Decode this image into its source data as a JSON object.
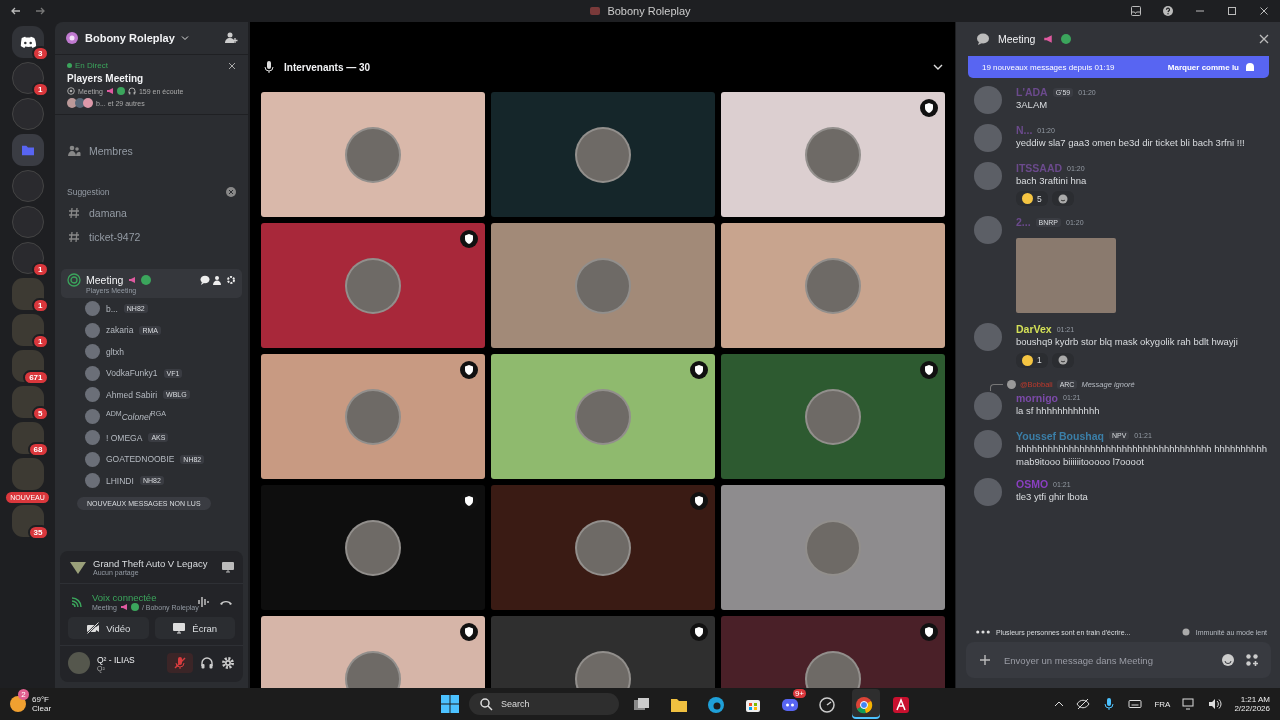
{
  "window": {
    "title": "Bobony Roleplay"
  },
  "servers": [
    {
      "kind": "home",
      "badge": "3"
    },
    {
      "kind": "server",
      "badge": "1"
    },
    {
      "kind": "server"
    },
    {
      "kind": "folder"
    },
    {
      "kind": "server"
    },
    {
      "kind": "server"
    },
    {
      "kind": "server",
      "badge": "1"
    },
    {
      "kind": "grid",
      "badge": "1"
    },
    {
      "kind": "grid",
      "badge": "1"
    },
    {
      "kind": "grid",
      "badge": "671"
    },
    {
      "kind": "grid",
      "badge": "5"
    },
    {
      "kind": "grid",
      "badge": "68"
    },
    {
      "kind": "grid"
    },
    {
      "kind": "grid",
      "badge": "35"
    }
  ],
  "new_pill": "NOUVEAU",
  "server_header": {
    "name": "Bobony Roleplay"
  },
  "live_event": {
    "status": "En Direct",
    "title": "Players Meeting",
    "channel": "Meeting",
    "listeners": "159 en écoute",
    "participants": "b... et 29 autres"
  },
  "members_link": "Membres",
  "category": {
    "name": "Suggestion",
    "channels": [
      "damana",
      "ticket-9472"
    ]
  },
  "voice_channel": {
    "name": "Meeting",
    "subtitle": "Players Meeting",
    "members": [
      {
        "name": "b...",
        "tag": "NH82"
      },
      {
        "name": "zakaria",
        "tag": "RMA"
      },
      {
        "name": "gltxh"
      },
      {
        "name": "VodkaFunky1",
        "tag": "VF1"
      },
      {
        "name": "Ahmed Sabiri",
        "tag": "WBLG"
      },
      {
        "name": "$^{ADM}$*Colonel*$^{RGA}$"
      },
      {
        "name": "! OMEGA",
        "tag": "AKS"
      },
      {
        "name": "GOATEDNOOBIE",
        "tag": "NH82"
      },
      {
        "name": "LHINDI",
        "tag": "NH82"
      }
    ]
  },
  "unread_pill": "NOUVEAUX MESSAGES NON LUS",
  "activity": {
    "game": "Grand Theft Auto V Legacy",
    "status": "Aucun partage"
  },
  "voice_status": {
    "title": "Voix connectée",
    "channel": "Meeting",
    "server": "/ Bobony Roleplay"
  },
  "media_buttons": [
    {
      "kind": "video",
      "label": "Vidéo"
    },
    {
      "kind": "screen",
      "label": "Écran"
    }
  ],
  "user": {
    "name": "Q² - ILIAS",
    "status": "Q²",
    "muted": true
  },
  "stage": {
    "title": "Intervenants — 30",
    "tiles": [
      {
        "color": "#d9b8aa",
        "shield": false
      },
      {
        "color": "#15262a",
        "shield": false
      },
      {
        "color": "#dccfd0",
        "shield": true
      },
      {
        "color": "#a8283a",
        "shield": true
      },
      {
        "color": "#a28a78",
        "shield": false
      },
      {
        "color": "#c8a48e",
        "shield": false
      },
      {
        "color": "#c89a82",
        "shield": true
      },
      {
        "color": "#8fba6e",
        "shield": true
      },
      {
        "color": "#2d5a30",
        "shield": true
      },
      {
        "color": "#0e0e0e",
        "shield": true
      },
      {
        "color": "#3a1b14",
        "shield": true
      },
      {
        "color": "#8e8c8e",
        "shield": false
      },
      {
        "color": "#d6b5a8",
        "shield": true
      },
      {
        "color": "#2f2f2f",
        "shield": true
      },
      {
        "color": "#4a2028",
        "shield": true
      }
    ]
  },
  "chat": {
    "title": "Meeting",
    "banner": {
      "text": "19 nouveaux messages depuis 01:19",
      "action": "Marquer comme lu"
    },
    "messages": [
      {
        "kind": "text",
        "author": "L'ADA",
        "color": "#6b4a8c",
        "tag": "G'59",
        "time": "01:20",
        "text": "3ALAM"
      },
      {
        "kind": "text",
        "author": "N...",
        "color": "#6b4a8c",
        "time": "01:20",
        "text": "yeddiw sla7 gaa3 omen be3d dir ticket bli bach 3rfni !!!"
      },
      {
        "kind": "text",
        "author": "ITSSAAD",
        "color": "#6b4a8c",
        "time": "01:20",
        "text": "bach 3raftini hna",
        "reactions": [
          "5"
        ]
      },
      {
        "kind": "image",
        "author": "2...",
        "color": "#6b4a8c",
        "tag": "BNRP",
        "time": "01:20"
      },
      {
        "kind": "text",
        "author": "DarVex",
        "color": "#d4e157",
        "time": "01:21",
        "text": "boushq9 kydrb stor blq mask okygolik rah bdlt hwayji",
        "reactions": [
          "1"
        ]
      },
      {
        "kind": "text",
        "author": "mornigo",
        "color": "#7b4aa8",
        "time": "01:21",
        "text": "la sf hhhhhhhhhhhh",
        "reply": {
          "author": "@Bobbali",
          "tag": "ARC",
          "text": "Message ignoré"
        }
      },
      {
        "kind": "text",
        "author": "Youssef Boushaq",
        "color": "#3b7fa8",
        "tag": "NPV",
        "time": "01:21",
        "text": "hhhhhhhhhhhhhhhhhhhhhhhhhhhhhhhhhhhhh hhhhhhhhhh mab9itooo biiiiiitooooo l7oooot"
      },
      {
        "kind": "text",
        "author": "OSMO",
        "color": "#8a3fc0",
        "time": "01:21",
        "text": "tle3 ytfi ghir lbota"
      }
    ],
    "typing": "Plusieurs personnes sont en train d'écrire...",
    "slowmode": "Immunité au mode lent",
    "placeholder": "Envoyer un message dans Meeting"
  },
  "taskbar": {
    "weather": {
      "temp": "69°F",
      "condition": "Clear",
      "badge": "2"
    },
    "search": "Search",
    "apps": [
      {
        "kind": "task-view",
        "active": false
      },
      {
        "kind": "folder",
        "active": false
      },
      {
        "kind": "browser",
        "active": false
      },
      {
        "kind": "store",
        "active": false
      },
      {
        "kind": "chat",
        "active": false,
        "badge": "9+"
      },
      {
        "kind": "gauge",
        "active": false
      },
      {
        "kind": "chrome",
        "active": true
      },
      {
        "kind": "letter",
        "active": false
      }
    ],
    "language": "FRA",
    "time": "1:21 AM",
    "date": "2/22/2026"
  }
}
